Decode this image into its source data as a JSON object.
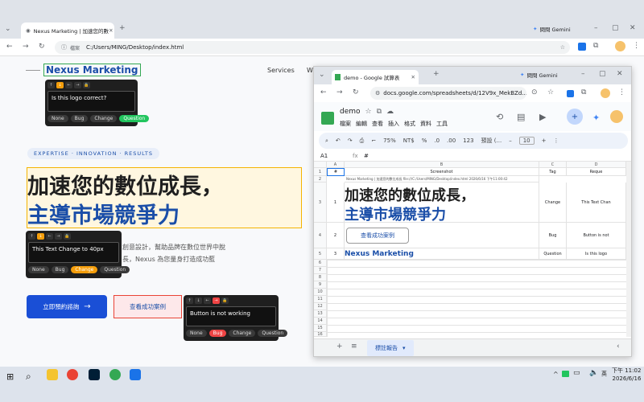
{
  "browser": {
    "tab_title": "Nexus Marketing | 加速您的數",
    "gemini_label": "問問 Gemini",
    "address_prefix": "檔案",
    "address": "C:/Users/MING/Desktop/index.html"
  },
  "site": {
    "logo": "Nexus Marketing",
    "nav": [
      "Services",
      "W"
    ],
    "tagline": "EXPERTISE · INNOVATION · RESULTS",
    "hero_line1": "加速您的數位成長，",
    "hero_line2": "主導市場競爭力",
    "desc_line1": "創意設計，幫助品牌在數位世界中脫",
    "desc_line2": "長，Nexus 為您量身打造成功藍",
    "cta_label": "立即預約諮詢",
    "case_label": "查看成功案例",
    "colors": {
      "primary": "#1a4fd6",
      "accent": "#f5b400",
      "highlight_green": "#34a853"
    }
  },
  "popups": {
    "buttons": [
      "None",
      "Bug",
      "Change",
      "Question"
    ],
    "arrows": [
      "↑",
      "↓",
      "←",
      "→",
      "🔒"
    ],
    "p1": {
      "text": "Is this logo correct?",
      "selected": "Question"
    },
    "p2": {
      "text": "This Text Change to 40px",
      "selected": "Change"
    },
    "p3": {
      "text": "Button is not working",
      "selected": "Bug"
    }
  },
  "window": {
    "tab_title": "demo - Google 試算表",
    "gemini_label": "問問 Gemini",
    "address": "docs.google.com/spreadsheets/d/12V9x_MekBZd...",
    "doc_title": "demo",
    "menu": [
      "檔案",
      "編輯",
      "查看",
      "插入",
      "格式",
      "資料",
      "工具"
    ],
    "zoom": "75%",
    "currency": "NT$",
    "percent": "%",
    "decimals": ".0",
    "decimals2": ".00",
    "format_123": "123",
    "font": "預設 (...",
    "font_size": "10",
    "cell_ref": "A1",
    "fx": "fx",
    "formula": "#",
    "columns": [
      "A",
      "B",
      "C",
      "D"
    ],
    "headers": [
      "#",
      "Screenshot",
      "Tag",
      "Reque"
    ],
    "row2_text": "Nexus Marketing | 加速您的數位成長    file:///C:/Users/MING/Desktop/index.html    2026/6/16 下午11:00:42",
    "rows": [
      {
        "num": "1",
        "shot_l1": "加速您的數位成長，",
        "shot_l2": "主導市場競爭力",
        "tag": "Change",
        "req": "This Text Chan"
      },
      {
        "num": "2",
        "shot_btn": "查看成功案例",
        "tag": "Bug",
        "req": "Button is not"
      },
      {
        "num": "3",
        "shot_logo": "Nexus Marketing",
        "tag": "Question",
        "req": "Is this logo"
      }
    ],
    "row_numbers": [
      "1",
      "2",
      "3",
      "4",
      "5",
      "6",
      "7",
      "8",
      "9",
      "10",
      "11",
      "12",
      "13",
      "14",
      "15",
      "16"
    ],
    "sheet_tab": "標註報告"
  },
  "taskbar": {
    "lang": "英",
    "time": "下午 11:02",
    "date": "2026/6/16"
  }
}
